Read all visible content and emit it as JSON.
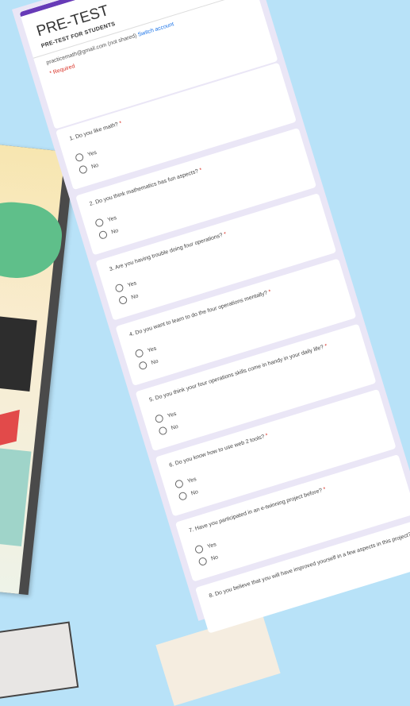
{
  "form": {
    "title": "PRE-TEST",
    "subtitle": "PRE-TEST FOR STUDENTS",
    "account": "practicemath@gmail.com (not shared)",
    "switch_account": "Switch account",
    "required_note": "* Required",
    "questions": [
      {
        "text": "1. Do you like math?",
        "options": [
          "Yes",
          "No"
        ]
      },
      {
        "text": "2. Do you think mathematics has fun aspects?",
        "options": [
          "Yes",
          "No"
        ]
      },
      {
        "text": "3. Are you having trouble doing four operations?",
        "options": [
          "Yes",
          "No"
        ]
      },
      {
        "text": "4. Do you want to learn to do the four operations mentally?",
        "options": [
          "Yes",
          "No"
        ]
      },
      {
        "text": "5. Do you think your four operations skills come in handy in your daily life?",
        "options": [
          "Yes",
          "No"
        ]
      },
      {
        "text": "6. Do you know how to use web 2 tools?",
        "options": [
          "Yes",
          "No"
        ]
      },
      {
        "text": "7. Have you participated in an e-twinning project before?",
        "options": [
          "Yes",
          "No"
        ]
      },
      {
        "text": "8. Do you believe that you will have improved yourself in a few aspects in this project?",
        "options": []
      }
    ]
  },
  "colors": {
    "background": "#b8e2f8",
    "form_accent": "#673ab7",
    "required": "#d93025"
  }
}
